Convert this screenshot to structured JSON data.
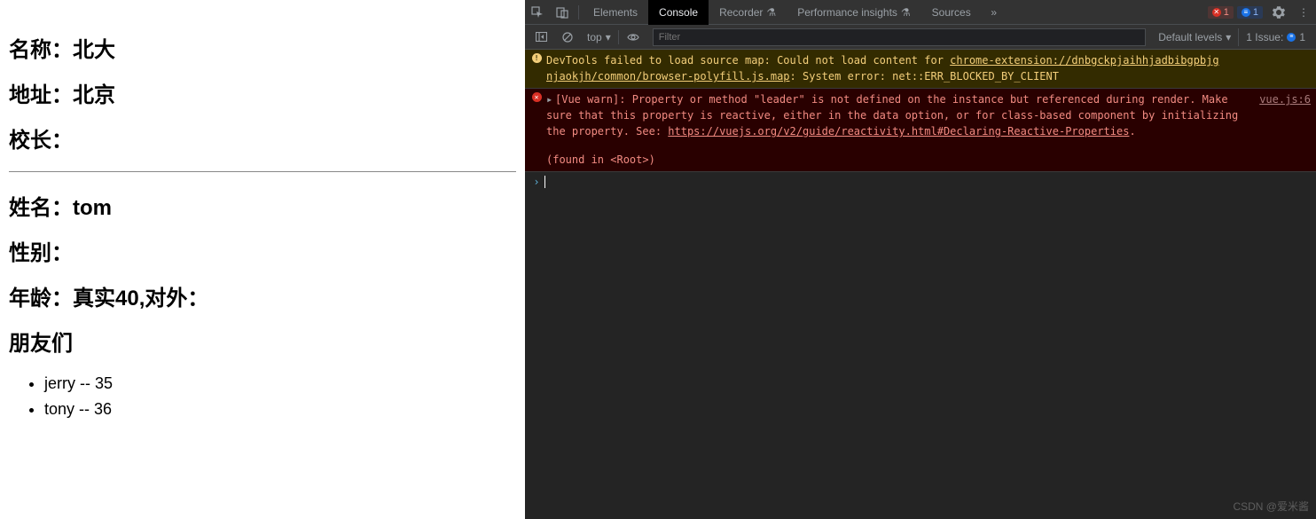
{
  "page": {
    "school_label": "名称：",
    "school_value": "北大",
    "addr_label": "地址：",
    "addr_value": "北京",
    "leader_label": "校长：",
    "leader_value": "",
    "name_label": "姓名：",
    "name_value": "tom",
    "gender_label": "性别：",
    "gender_value": "",
    "age_label": "年龄：",
    "age_value": "真实40,对外：",
    "friends_label": "朋友们",
    "friends": [
      "jerry -- 35",
      "tony -- 36"
    ]
  },
  "devtools": {
    "tabs": {
      "elements": "Elements",
      "console": "Console",
      "recorder": "Recorder",
      "perf": "Performance insights",
      "sources": "Sources"
    },
    "err_count": "1",
    "info_count": "1",
    "toolbar": {
      "context": "top",
      "filter_placeholder": "Filter",
      "levels": "Default levels",
      "issue_label": "1 Issue:",
      "issue_count": "1"
    },
    "warn_msg_a": "DevTools failed to load source map: Could not load content for ",
    "warn_link1": "chrome-extension://dnbgckpjaihhjadbibgpbjg",
    "warn_link2": "njaokjh/common/browser-polyfill.js.map",
    "warn_msg_b": ": System error: net::ERR_BLOCKED_BY_CLIENT",
    "err_msg_a": "[Vue warn]: Property or method \"leader\" is not defined on the instance but referenced during render. Make sure that this property is reactive, either in the data option, or for class-based component by initializing the property. See: ",
    "err_link": "https://vuejs.org/v2/guide/reactivity.html#Declaring-Reactive-Properties",
    "err_msg_b": ".",
    "err_found": "(found in <Root>)",
    "err_src": "vue.js:6"
  },
  "watermark": "CSDN @爱米酱"
}
